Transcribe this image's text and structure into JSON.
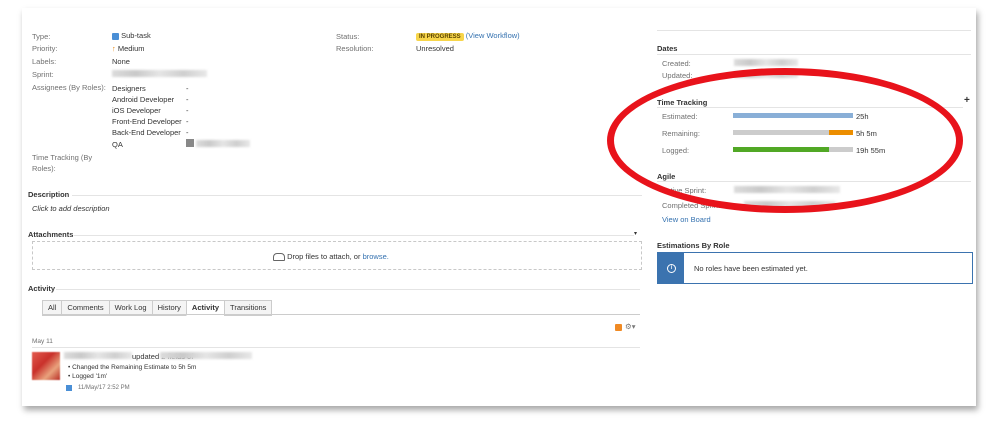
{
  "details": {
    "fields": [
      {
        "label": "Type:",
        "value": "Sub-task"
      },
      {
        "label": "Priority:",
        "value": "Medium"
      },
      {
        "label": "Labels:",
        "value": "None"
      },
      {
        "label": "Sprint:",
        "value": ""
      },
      {
        "label": "Assignees (By Roles):",
        "value": ""
      }
    ],
    "status_label": "Status:",
    "status_value": "IN PROGRESS",
    "view_workflow": "(View Workflow)",
    "resolution_label": "Resolution:",
    "resolution_value": "Unresolved",
    "roles": [
      {
        "name": "Designers",
        "value": "-"
      },
      {
        "name": "Android Developer",
        "value": "-"
      },
      {
        "name": "iOS Developer",
        "value": "-"
      },
      {
        "name": "Front-End Developer",
        "value": "-"
      },
      {
        "name": "Back-End Developer",
        "value": "-"
      },
      {
        "name": "QA",
        "value": ""
      }
    ],
    "time_tracking_label_1": "Time Tracking (By",
    "time_tracking_label_2": "Roles):"
  },
  "description": {
    "title": "Description",
    "placeholder": "Click to add description"
  },
  "attachments": {
    "title": "Attachments",
    "drop_text": "Drop files to attach, or",
    "browse": "browse."
  },
  "activity": {
    "title": "Activity",
    "tabs": [
      "All",
      "Comments",
      "Work Log",
      "History",
      "Activity",
      "Transitions"
    ],
    "active_tab": "Activity",
    "date": "May 11",
    "entry_action": "updated 2 fields of",
    "entry_items": [
      "Changed the Remaining Estimate to 5h 5m",
      "Logged '1m'"
    ],
    "entry_time": "11/May/17 2:52 PM"
  },
  "dates": {
    "title": "Dates",
    "created_label": "Created:",
    "updated_label": "Updated:"
  },
  "time_tracking": {
    "title": "Time Tracking",
    "rows": [
      {
        "label": "Estimated:",
        "value": "25h",
        "fraction": 1.0,
        "remaining_fraction": 0
      },
      {
        "label": "Remaining:",
        "value": "5h 5m",
        "fraction": 0.8,
        "remaining_fraction": 0.2
      },
      {
        "label": "Logged:",
        "value": "19h 55m",
        "fraction": 0.8,
        "remaining_fraction": 0.2
      }
    ],
    "colors": {
      "estimated": "#89afd7",
      "remaining": "#ec8e00",
      "logged": "#51a825",
      "empty": "#cccccc"
    }
  },
  "agile": {
    "title": "Agile",
    "active_sprint_label": "Active Sprint:",
    "completed_sprint_label": "Completed Sprint:",
    "view_on_board": "View on Board"
  },
  "estimations": {
    "title": "Estimations By Role",
    "message": "No roles have been estimated yet."
  },
  "add_icon_glyph": "+",
  "colors": {
    "highlight_ellipse": "#e8131b",
    "link": "#3572b0",
    "info_blue": "#3b73af"
  }
}
